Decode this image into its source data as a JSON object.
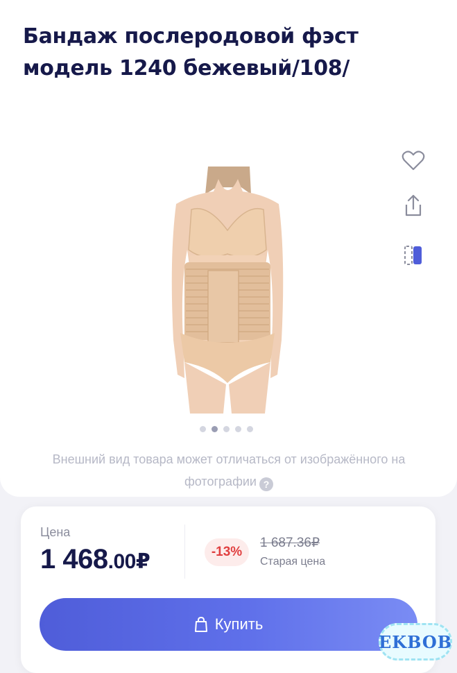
{
  "product": {
    "title": "Бандаж послеродовой фэст модель 1240 бежевый/108/",
    "disclaimer": "Внешний вид товара может отличаться от изображённого на фотографии",
    "help_icon": "?"
  },
  "gallery": {
    "image_count": 5,
    "active_index": 1
  },
  "actions": {
    "favorite_icon": "heart-outline",
    "share_icon": "share-upload",
    "compare_icon": "compare-panel"
  },
  "price": {
    "label": "Цена",
    "main": "1 468",
    "cents": ".00",
    "currency": "₽",
    "discount": "-13%",
    "old_price": "1 687.36₽",
    "old_label": "Старая цена"
  },
  "buy": {
    "label": "Купить",
    "icon": "shopping-bag"
  },
  "watermark": {
    "text": "EKBOB"
  },
  "colors": {
    "title": "#16194a",
    "accent": "#5866e0",
    "discount_text": "#e03f3f",
    "discount_bg": "#fdeceb"
  }
}
